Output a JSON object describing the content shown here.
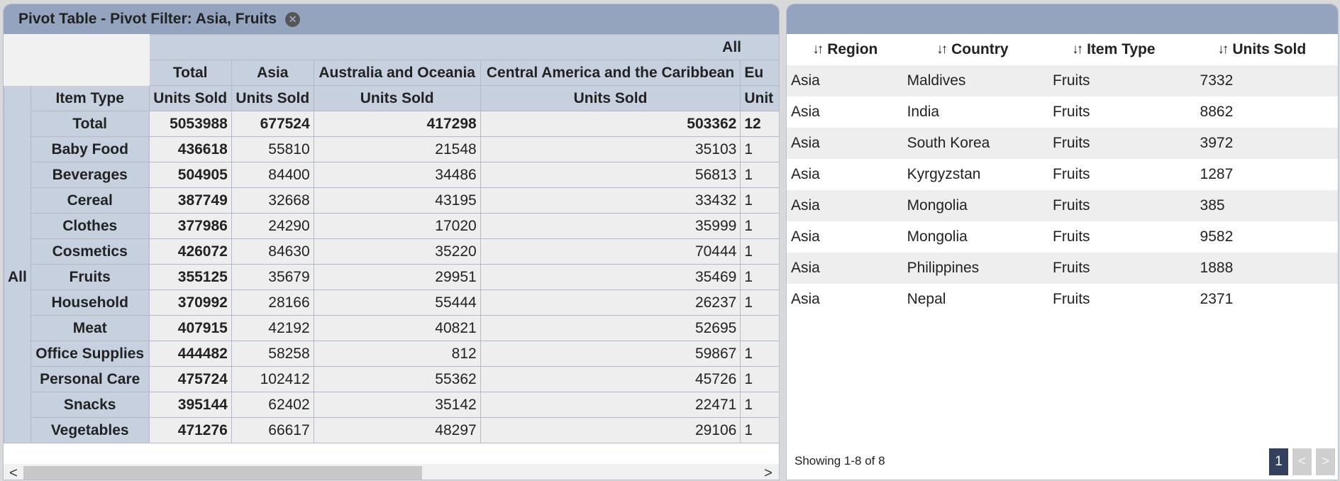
{
  "left_panel": {
    "title": "Pivot Table - Pivot Filter: Asia, Fruits",
    "close_icon": "close-icon",
    "col_group": "All",
    "col_headers": [
      "Total",
      "Asia",
      "Australia and Oceania",
      "Central America and the Caribbean",
      "Eu"
    ],
    "measure": "Units Sold",
    "measure_partial": "Unit",
    "row_field": "Item Type",
    "row_group": "All",
    "rows": [
      {
        "label": "Total",
        "values": [
          "5053988",
          "677524",
          "417298",
          "503362",
          "12"
        ],
        "bold": true
      },
      {
        "label": "Baby Food",
        "values": [
          "436618",
          "55810",
          "21548",
          "35103",
          "1"
        ]
      },
      {
        "label": "Beverages",
        "values": [
          "504905",
          "84400",
          "34486",
          "56813",
          "1"
        ]
      },
      {
        "label": "Cereal",
        "values": [
          "387749",
          "32668",
          "43195",
          "33432",
          "1"
        ]
      },
      {
        "label": "Clothes",
        "values": [
          "377986",
          "24290",
          "17020",
          "35999",
          "1"
        ]
      },
      {
        "label": "Cosmetics",
        "values": [
          "426072",
          "84630",
          "35220",
          "70444",
          "1"
        ]
      },
      {
        "label": "Fruits",
        "values": [
          "355125",
          "35679",
          "29951",
          "35469",
          "1"
        ]
      },
      {
        "label": "Household",
        "values": [
          "370992",
          "28166",
          "55444",
          "26237",
          "1"
        ]
      },
      {
        "label": "Meat",
        "values": [
          "407915",
          "42192",
          "40821",
          "52695",
          ""
        ]
      },
      {
        "label": "Office Supplies",
        "values": [
          "444482",
          "58258",
          "812",
          "59867",
          "1"
        ]
      },
      {
        "label": "Personal Care",
        "values": [
          "475724",
          "102412",
          "55362",
          "45726",
          "1"
        ]
      },
      {
        "label": "Snacks",
        "values": [
          "395144",
          "62402",
          "35142",
          "22471",
          "1"
        ]
      },
      {
        "label": "Vegetables",
        "values": [
          "471276",
          "66617",
          "48297",
          "29106",
          "1"
        ]
      }
    ],
    "scroll_left": "<",
    "scroll_right": ">"
  },
  "right_panel": {
    "columns": [
      "Region",
      "Country",
      "Item Type",
      "Units Sold"
    ],
    "sort_icon": "↓↑",
    "rows": [
      [
        "Asia",
        "Maldives",
        "Fruits",
        "7332"
      ],
      [
        "Asia",
        "India",
        "Fruits",
        "8862"
      ],
      [
        "Asia",
        "South Korea",
        "Fruits",
        "3972"
      ],
      [
        "Asia",
        "Kyrgyzstan",
        "Fruits",
        "1287"
      ],
      [
        "Asia",
        "Mongolia",
        "Fruits",
        "385"
      ],
      [
        "Asia",
        "Mongolia",
        "Fruits",
        "9582"
      ],
      [
        "Asia",
        "Philippines",
        "Fruits",
        "1888"
      ],
      [
        "Asia",
        "Nepal",
        "Fruits",
        "2371"
      ]
    ],
    "footer": "Showing 1-8 of 8",
    "pager": {
      "current": "1",
      "prev": "<",
      "next": ">"
    }
  }
}
